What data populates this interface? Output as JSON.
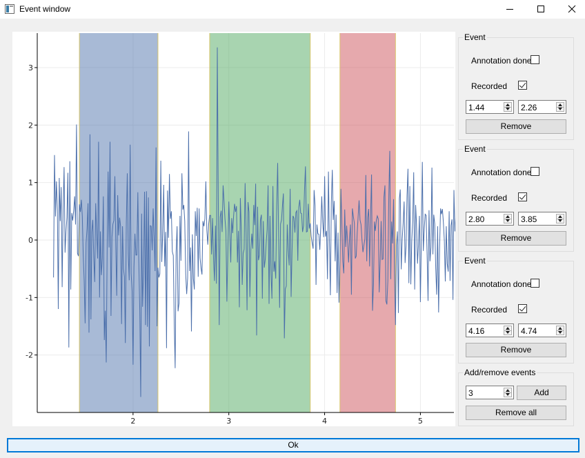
{
  "window": {
    "title": "Event window",
    "controls": [
      "minimize-icon",
      "maximize-icon",
      "close-icon"
    ]
  },
  "chart_data": {
    "type": "line",
    "xlim": [
      1.0,
      5.35
    ],
    "ylim": [
      -3.0,
      3.6
    ],
    "x_ticks": [
      "2",
      "3",
      "4",
      "5"
    ],
    "y_ticks": [
      "3",
      "2",
      "1",
      "0",
      "-1",
      "-2"
    ],
    "x_tick_values": [
      2,
      3,
      4,
      5
    ],
    "y_tick_values": [
      3,
      2,
      1,
      0,
      -1,
      -2
    ],
    "grid": true,
    "series_color": "#4a6eaa",
    "regions": [
      {
        "start": 1.44,
        "end": 2.26,
        "color": "#4a6eaa"
      },
      {
        "start": 2.8,
        "end": 3.85,
        "color": "#4aa55a"
      },
      {
        "start": 4.16,
        "end": 4.74,
        "color": "#cb4c54"
      }
    ],
    "x_start": 1.17,
    "x_step": 0.01,
    "values": [
      -0.65,
      1.48,
      0.41,
      1.02,
      0.52,
      -1.2,
      1.08,
      0.33,
      0.92,
      -0.82,
      0.52,
      1.27,
      -0.22,
      0.15,
      0.39,
      1.17,
      -1.87,
      1.37,
      -0.86,
      0.47,
      0.34,
      0.51,
      0.76,
      0.27,
      2.01,
      -0.23,
      -0.28,
      0.62,
      0.49,
      0.7,
      0.42,
      -0.24,
      -0.7,
      -1.45,
      -0.05,
      0.2,
      0.64,
      -1.61,
      1.84,
      -1.38,
      0.14,
      0.35,
      -0.3,
      -0.73,
      0.64,
      0.12,
      -0.32,
      1.71,
      -1.0,
      0.15,
      -0.61,
      -0.32,
      0.76,
      -1.74,
      -1.23,
      -2.13,
      -0.06,
      1.19,
      -0.13,
      1.71,
      -1.32,
      0.05,
      0.28,
      0.34,
      1.11,
      -0.12,
      -0.97,
      0.78,
      0.08,
      0.39,
      0.24,
      -1.46,
      0.24,
      -0.5,
      -0.64,
      -1.79,
      0.3,
      1.16,
      -0.24,
      -0.7,
      1.66,
      -0.58,
      -0.89,
      -2.17,
      -0.47,
      0.11,
      -0.26,
      -0.26,
      0.83,
      -0.36,
      -1.21,
      -2.73,
      0.46,
      -1.16,
      -0.51,
      0.84,
      -1.48,
      0.85,
      -1.51,
      0.74,
      -1.85,
      0.25,
      0.24,
      -0.18,
      0.55,
      0.06,
      -0.54,
      1.61,
      -1.5,
      -0.48,
      -0.65,
      -0.59,
      1.38,
      -0.38,
      0.14,
      0.96,
      -0.46,
      0.14,
      -1.88,
      0.86,
      0.04,
      1.15,
      0.37,
      0.5,
      -0.2,
      -0.27,
      -1.46,
      -2.23,
      -0.21,
      0.24,
      -1.24,
      -1.1,
      0.42,
      -0.36,
      1.16,
      0.53,
      0.61,
      0.33,
      -0.59,
      -0.94,
      -0.66,
      1.89,
      -0.54,
      -0.13,
      -1.59,
      0.1,
      -0.67,
      -0.86,
      0.5,
      0.07,
      0.56,
      -0.64,
      0.55,
      -0.31,
      -0.49,
      -0.6,
      0.33,
      0.24,
      0.37,
      1.02,
      0.18,
      -0.08,
      0.28,
      0.43,
      0.43,
      -0.25,
      0.38,
      -0.31,
      -0.71,
      0.25,
      -0.76,
      3.35,
      0.76,
      -1.48,
      0.4,
      0.51,
      0.14,
      0.95,
      0.67,
      0.37,
      0.16,
      -1.07,
      -0.16,
      0.67,
      0.15,
      -0.39,
      0.38,
      0.12,
      0.41,
      0.63,
      0.49,
      0.59,
      -0.39,
      0.16,
      -1.17,
      0.73,
      0.16,
      -0.78,
      -0.23,
      -0.16,
      0.99,
      0.13,
      -1.22,
      0.66,
      0.49,
      -0.99,
      -0.17,
      0.11,
      -0.15,
      0.61,
      0.26,
      0.98,
      -1.66,
      0.58,
      -0.35,
      -0.26,
      0.35,
      0.44,
      -1.02,
      0.33,
      -0.48,
      -0.34,
      -0.04,
      0.18,
      0.95,
      -1.11,
      0.42,
      -0.58,
      -1.02,
      0.94,
      -0.55,
      -0.37,
      -0.67,
      0.58,
      1.34,
      0.04,
      -1.18,
      0.28,
      0.35,
      0.61,
      0.81,
      -1.71,
      -0.85,
      -0.8,
      0.27,
      -0.17,
      -0.44,
      0.89,
      -0.99,
      -0.21,
      0.42,
      0.38,
      0.13,
      0.48,
      0.51,
      -0.36,
      0.57,
      0.7,
      0.47,
      0.46,
      0.14,
      0.25,
      0.87,
      1.28,
      0.14,
      0.15,
      0.63,
      0.2,
      0.29,
      0.06,
      -0.05,
      -0.15,
      0.87,
      0.6,
      -0.78,
      0.27,
      0.11,
      0.1,
      -0.17,
      0.22,
      0.76,
      0.31,
      0.05,
      1.11,
      0.06,
      0.16,
      -0.68,
      1.19,
      -0.01,
      -0.96,
      0.65,
      1.22,
      0.35,
      0.68,
      -0.37,
      0.44,
      -0.92,
      0.13,
      -1.09,
      -0.35,
      0.89,
      0.29,
      -0.37,
      -0.58,
      0.53,
      -0.12,
      0.25,
      -0.03,
      -0.39,
      0.04,
      0.27,
      -0.95,
      0.55,
      0.41,
      0.3,
      -0.32,
      -0.28,
      0.13,
      0.4,
      0.69,
      0.35,
      0.27,
      0.01,
      -0.21,
      -0.09,
      0.02,
      1.13,
      -0.37,
      0.39,
      0.54,
      -0.46,
      0.42,
      1.14,
      -1.23,
      -0.77,
      0.32,
      0.16,
      0.34,
      0.42,
      0.37,
      -0.91,
      -0.35,
      0.33,
      -0.34,
      -0.33,
      0.75,
      0.95,
      -1.06,
      -1.12,
      -0.71,
      0.74,
      1.55,
      -0.68,
      0.32,
      -0.06,
      0.71,
      -0.56,
      -1.48,
      -0.09,
      0.15,
      -1.27,
      0.72,
      0.88,
      -0.51,
      0.01,
      0.29,
      0.67,
      -0.4,
      -0.11,
      0.77,
      1.24,
      -0.75,
      0.94,
      -0.77,
      -0.01,
      0.34,
      1.18,
      -0.86,
      0.61,
      0.27,
      -0.41,
      -0.09,
      0.42,
      -1.08,
      0.03,
      1.36,
      -0.19,
      0.2,
      0.45,
      0.43,
      -0.24,
      -1.06,
      0.52,
      -0.37,
      -0.13,
      1.26,
      -0.25,
      0.44,
      0.28,
      -0.49,
      -0.95,
      0.24,
      -1.26,
      -0.16,
      0.55,
      0.45,
      0.54,
      0.31,
      -0.01,
      -0.72,
      0.24,
      -0.41,
      -0.55,
      0.5,
      -0.71,
      0.25,
      0.36,
      -1.04,
      0.87,
      0.15,
      0.45,
      0.43,
      0.45,
      0.36,
      0.6,
      0.23,
      0.02,
      0.01,
      -0.16,
      -0.46,
      0.11,
      0.4,
      0.34,
      -0.47,
      0.29,
      0.93,
      0.22,
      -0.52,
      0.13,
      -0.66,
      0.1,
      0.73,
      -0.91,
      0.09,
      0.14,
      0.35,
      0.05,
      0.77,
      0.71,
      0.12,
      -0.26,
      0.44,
      -0.17,
      0.91,
      0.12,
      -0.46,
      0.31,
      0.23,
      0.39,
      0.73,
      0.68
    ]
  },
  "events": [
    {
      "title": "Event",
      "annotation_label": "Annotation done",
      "annotation_checked": false,
      "recorded_label": "Recorded",
      "recorded_checked": true,
      "start": "1.44",
      "end": "2.26",
      "remove_label": "Remove"
    },
    {
      "title": "Event",
      "annotation_label": "Annotation done",
      "annotation_checked": false,
      "recorded_label": "Recorded",
      "recorded_checked": true,
      "start": "2.80",
      "end": "3.85",
      "remove_label": "Remove"
    },
    {
      "title": "Event",
      "annotation_label": "Annotation done",
      "annotation_checked": false,
      "recorded_label": "Recorded",
      "recorded_checked": true,
      "start": "4.16",
      "end": "4.74",
      "remove_label": "Remove"
    }
  ],
  "add_remove": {
    "title": "Add/remove events",
    "count": "3",
    "add_label": "Add",
    "remove_all_label": "Remove all"
  },
  "ok_label": "Ok"
}
